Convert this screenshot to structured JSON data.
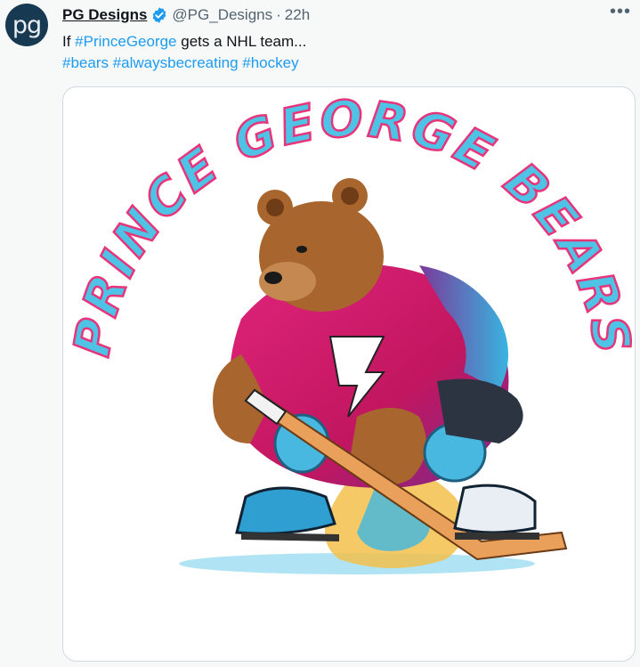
{
  "tweet": {
    "avatar_text": "pg",
    "display_name": "PG Designs",
    "handle": "@PG_Designs",
    "separator": "·",
    "time": "22h",
    "more_label": "•••",
    "text_prefix": "If ",
    "hashtag_princegeorge": "#PrinceGeorge",
    "text_suffix": " gets a NHL team...",
    "hashtags": [
      "#bears",
      "#alwaysbecreating",
      "#hockey"
    ]
  },
  "media": {
    "logo_text": "PRINCE GEORGE BEARS",
    "colors": {
      "text_fill": "#4ec3e6",
      "text_outline": "#e8347a",
      "jersey": "#d91a6b",
      "bear": "#a8662e",
      "skate": "#2f9fd1"
    }
  },
  "icons": {
    "verified": "verified-badge-icon",
    "more": "more-icon"
  }
}
